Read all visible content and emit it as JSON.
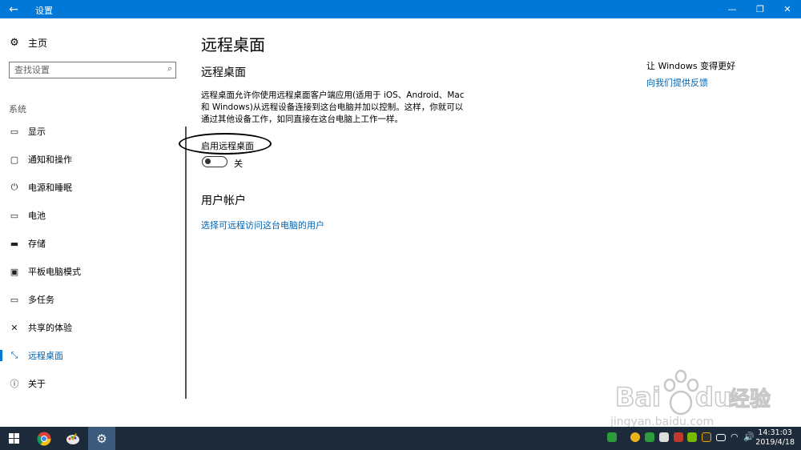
{
  "window": {
    "title": "设置",
    "back_icon": "arrow-left-icon",
    "controls": [
      "minimize-icon",
      "restore-icon",
      "close-icon"
    ]
  },
  "sidebar": {
    "home_label": "主页",
    "search_placeholder": "查找设置",
    "section_label": "系统",
    "items": [
      {
        "label": "显示",
        "icon": "monitor-icon"
      },
      {
        "label": "通知和操作",
        "icon": "message-icon"
      },
      {
        "label": "电源和睡眠",
        "icon": "power-icon"
      },
      {
        "label": "电池",
        "icon": "battery-icon"
      },
      {
        "label": "存储",
        "icon": "storage-icon"
      },
      {
        "label": "平板电脑模式",
        "icon": "tablet-icon"
      },
      {
        "label": "多任务",
        "icon": "multitask-icon"
      },
      {
        "label": "共享的体验",
        "icon": "share-icon"
      },
      {
        "label": "远程桌面",
        "icon": "remote-icon",
        "active": true
      },
      {
        "label": "关于",
        "icon": "info-icon"
      }
    ]
  },
  "main": {
    "title": "远程桌面",
    "subtitle": "远程桌面",
    "description": "远程桌面允许你使用远程桌面客户端应用(适用于 iOS、Android、Mac 和 Windows)从远程设备连接到这台电脑并加以控制。这样，你就可以通过其他设备工作，如同直接在这台电脑上工作一样。",
    "toggle_label": "启用远程桌面",
    "toggle_state": "关",
    "toggle_on": false,
    "user_section_title": "用户帐户",
    "user_link": "选择可远程访问这台电脑的用户"
  },
  "aside": {
    "heading": "让 Windows 变得更好",
    "link": "向我们提供反馈"
  },
  "taskbar": {
    "time": "14:31:03",
    "date": "2019/4/18"
  },
  "watermark": {
    "brand": "Bai",
    "brand2": "du",
    "suffix": "经验",
    "url": "jingyan.baidu.com"
  },
  "colors": {
    "accent": "#0078d7",
    "link": "#0063b1",
    "taskbar": "#1c2a3a"
  }
}
